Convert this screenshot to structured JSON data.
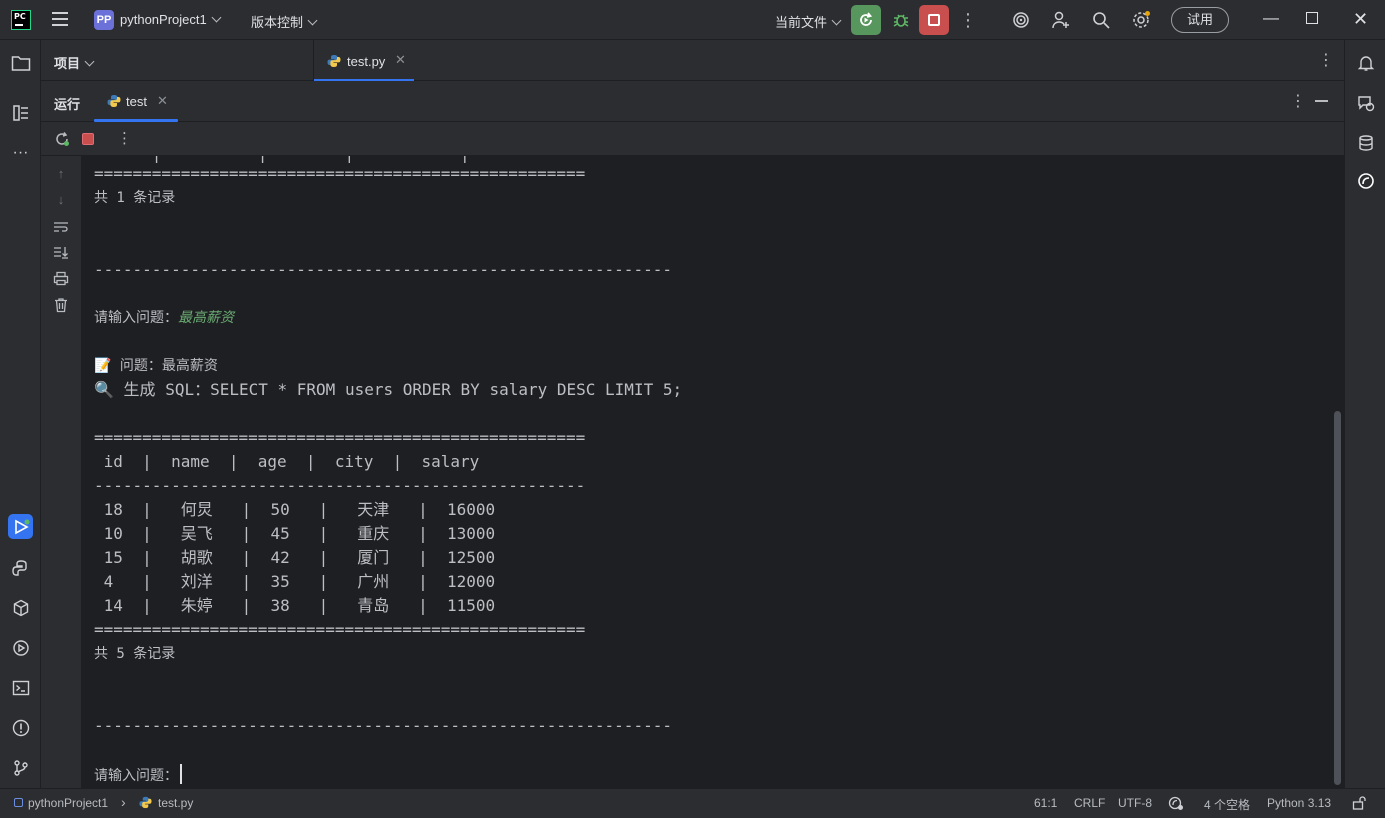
{
  "titlebar": {
    "project_badge": "PP",
    "project_name": "pythonProject1",
    "vcs_label": "版本控制",
    "current_file_label": "当前文件",
    "trial_label": "试用"
  },
  "toolwindow": {
    "project_label": "项目",
    "editor_tab": "test.py"
  },
  "run_panel": {
    "run_label": "运行",
    "run_tab": "test"
  },
  "console": {
    "lines": [
      {
        "text": "==================================================="
      },
      {
        "text": "共 1 条记录"
      },
      {
        "text": "------------------------------------------------------------"
      },
      {
        "prompt": "请输入问题：",
        "answer": "最高薪资"
      },
      {
        "text": "📝 问题：最高薪资"
      },
      {
        "text": "🔍 生成 SQL：SELECT * FROM users ORDER BY salary DESC LIMIT 5;"
      },
      {
        "text": "==================================================="
      },
      {
        "text": " id  |  name  |  age  |  city  |  salary"
      },
      {
        "text": "---------------------------------------------------"
      },
      {
        "text": " 18  |   何炅   |  50   |   天津   |  16000"
      },
      {
        "text": " 10  |   吴飞   |  45   |   重庆   |  13000"
      },
      {
        "text": " 15  |   胡歌   |  42   |   厦门   |  12500"
      },
      {
        "text": " 4   |   刘洋   |  35   |   广州   |  12000"
      },
      {
        "text": " 14  |   朱婷   |  38   |   青岛   |  11500"
      },
      {
        "text": "==================================================="
      },
      {
        "text": "共 5 条记录"
      },
      {
        "text": "------------------------------------------------------------"
      },
      {
        "prompt": "请输入问题：",
        "answer": ""
      }
    ]
  },
  "statusbar": {
    "breadcrumb_project": "pythonProject1",
    "breadcrumb_file": "test.py",
    "position": "61:1",
    "line_ending": "CRLF",
    "encoding": "UTF-8",
    "indent": "4 个空格",
    "interpreter": "Python 3.13"
  },
  "colors": {
    "accent": "#3574f0",
    "run_green": "#57965c",
    "stop_red": "#c94f4f",
    "input_green": "#6aab73"
  }
}
